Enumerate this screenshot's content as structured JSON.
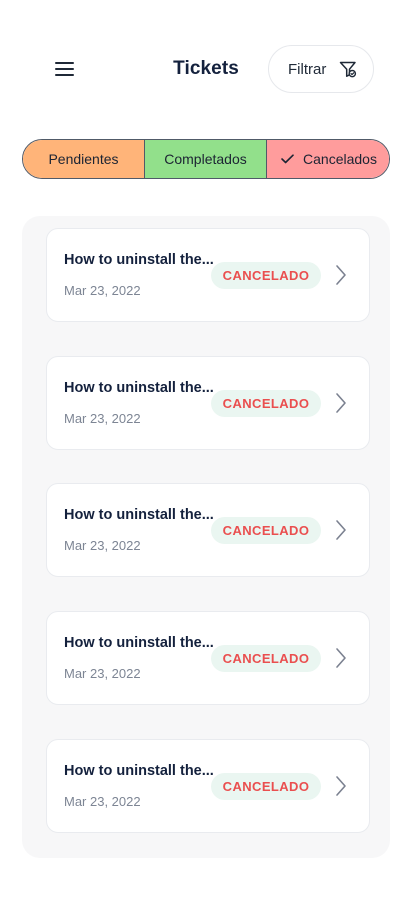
{
  "header": {
    "title": "Tickets",
    "menu_icon": "hamburger-menu-icon",
    "filter_label": "Filtrar",
    "filter_icon": "filter-funnel-icon"
  },
  "tabs": [
    {
      "label": "Pendientes",
      "color": "#ffb479",
      "selected": false
    },
    {
      "label": "Completados",
      "color": "#92e08b",
      "selected": false
    },
    {
      "label": "Cancelados",
      "color": "#ff9c9c",
      "selected": true,
      "icon": "check-icon"
    }
  ],
  "tickets": [
    {
      "title": "How to uninstall the...",
      "date": "Mar 23, 2022",
      "status": "CANCELADO"
    },
    {
      "title": "How to uninstall the...",
      "date": "Mar 23, 2022",
      "status": "CANCELADO"
    },
    {
      "title": "How to uninstall the...",
      "date": "Mar 23, 2022",
      "status": "CANCELADO"
    },
    {
      "title": "How to uninstall the...",
      "date": "Mar 23, 2022",
      "status": "CANCELADO"
    },
    {
      "title": "How to uninstall the...",
      "date": "Mar 23, 2022",
      "status": "CANCELADO"
    }
  ],
  "colors": {
    "status_text": "#ea4f4f",
    "status_bg": "#eaf6f1",
    "title_text": "#14213d",
    "date_text": "#7d8594"
  }
}
